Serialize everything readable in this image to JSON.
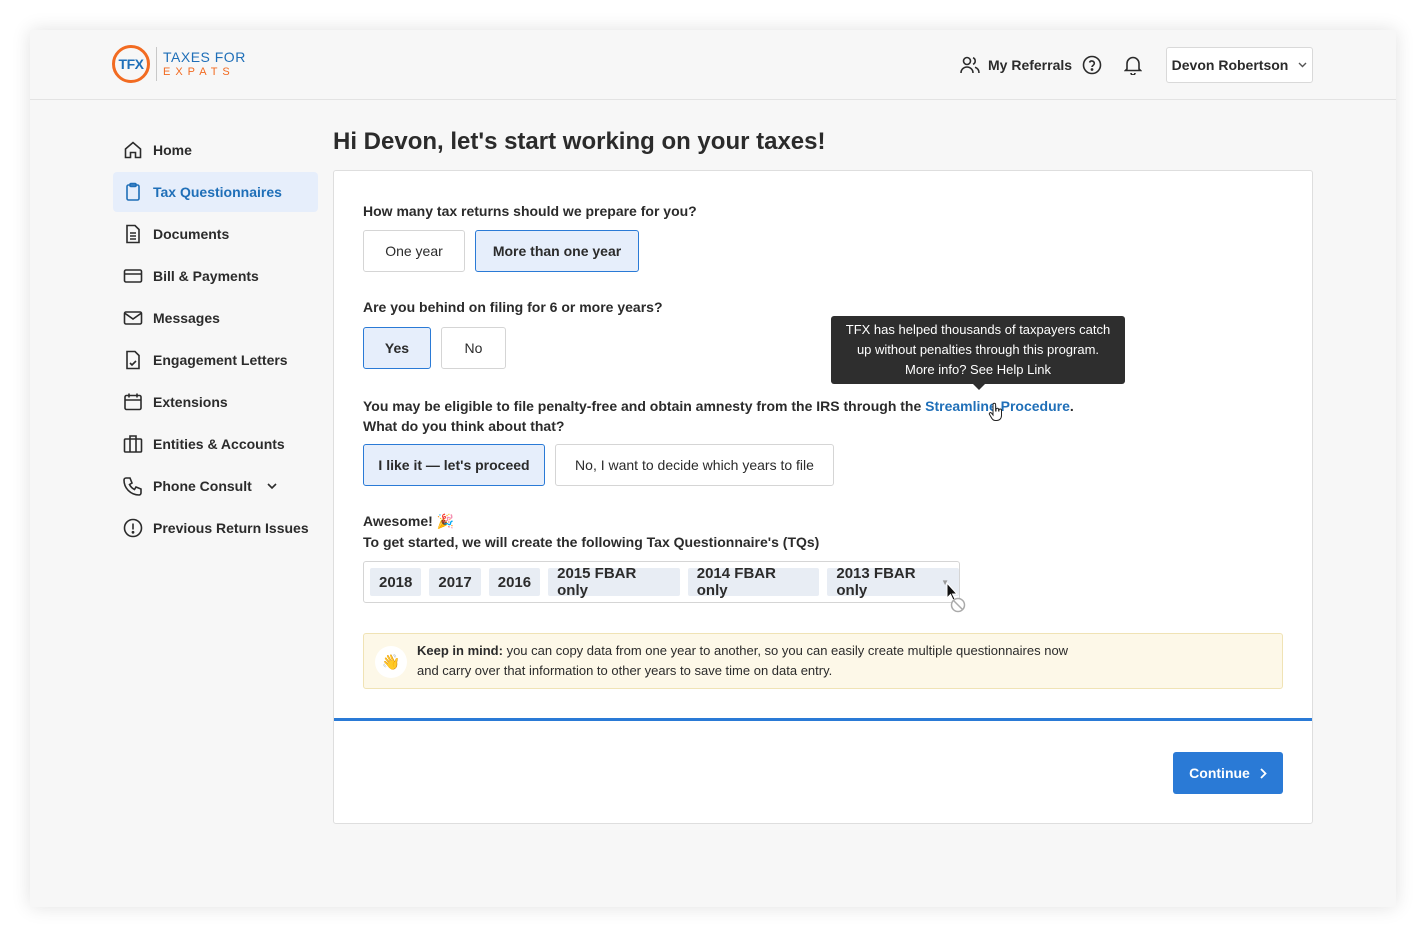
{
  "brand": {
    "mark": "TFX",
    "line1": "TAXES FOR",
    "line2": "EXPATS",
    "orange": "#f26b21",
    "blue": "#1f6fb8"
  },
  "header": {
    "referrals_label": "My Referrals",
    "user_name": "Devon Robertson"
  },
  "sidebar": {
    "items": [
      {
        "label": "Home",
        "icon": "home-icon"
      },
      {
        "label": "Tax Questionnaires",
        "icon": "clipboard-icon"
      },
      {
        "label": "Documents",
        "icon": "document-icon"
      },
      {
        "label": "Bill & Payments",
        "icon": "credit-card-icon"
      },
      {
        "label": "Messages",
        "icon": "mail-icon"
      },
      {
        "label": "Engagement Letters",
        "icon": "signed-document-icon"
      },
      {
        "label": "Extensions",
        "icon": "calendar-icon"
      },
      {
        "label": "Entities & Accounts",
        "icon": "building-icon"
      },
      {
        "label": "Phone Consult",
        "icon": "phone-icon"
      },
      {
        "label": "Previous Return Issues",
        "icon": "alert-circle-icon"
      }
    ]
  },
  "main": {
    "title": "Hi Devon, let's start working on your taxes!",
    "q1": {
      "text": "How many tax returns should we prepare for you?",
      "options": [
        "One year",
        "More than one year"
      ]
    },
    "q2": {
      "text": "Are you behind on filing for 6 or more years?",
      "options": [
        "Yes",
        "No"
      ]
    },
    "q3": {
      "text_before": "You may be eligible to file penalty-free and obtain amnesty from the IRS through the ",
      "link": "Streamline Procedure",
      "text_after": ".",
      "line2": "What do you think about that?",
      "options": [
        "I like it — let's proceed",
        "No, I want to decide which years to file"
      ]
    },
    "tooltip": {
      "line1": "TFX has helped thousands of taxpayers catch",
      "line2": "up without penalties through this program.",
      "line3": "More info? See Help Link"
    },
    "awesome": "Awesome! 🎉",
    "tq_intro": "To get started, we will create the following Tax Questionnaire's (TQs)",
    "tags": [
      "2018",
      "2017",
      "2016",
      "2015 FBAR only",
      "2014 FBAR only",
      "2013 FBAR only"
    ],
    "notice": {
      "emoji": "👋",
      "bold": "Keep in mind:",
      "text1": " you can copy data from one year to another, so you can easily create multiple questionnaires now",
      "text2": "and carry over that information to other years to save time on data entry."
    },
    "continue_label": "Continue"
  }
}
